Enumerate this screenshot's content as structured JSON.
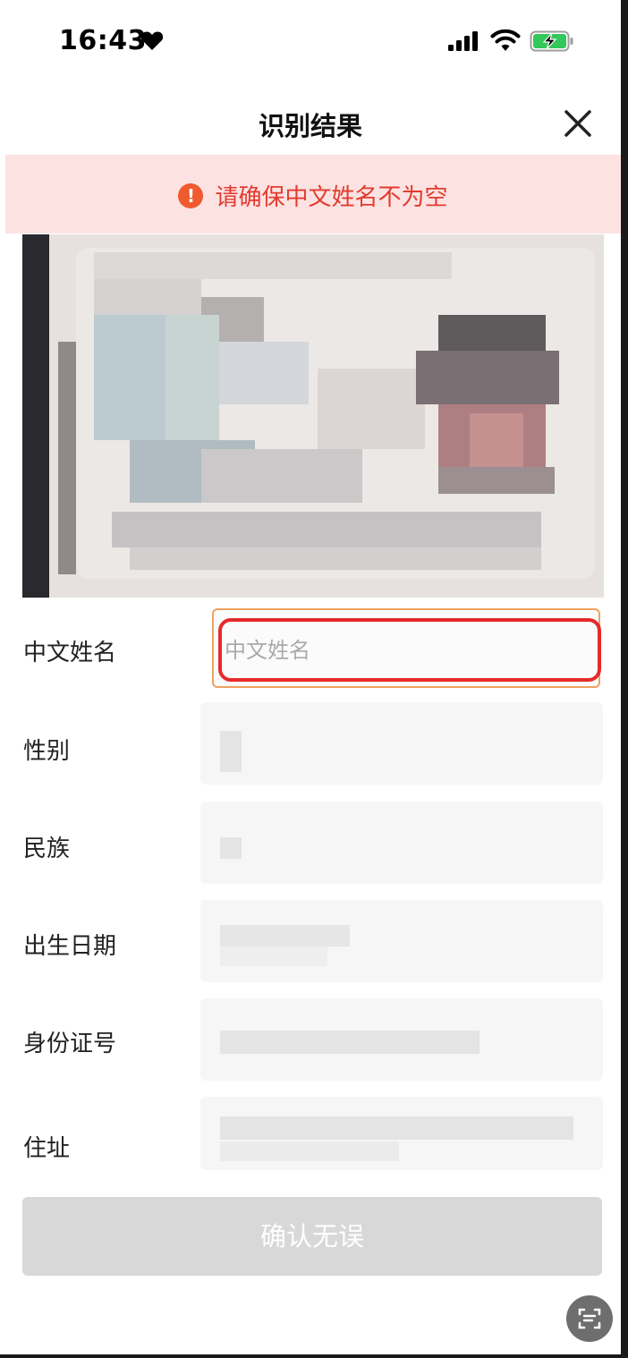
{
  "status_bar": {
    "time": "16:43"
  },
  "header": {
    "title": "识别结果"
  },
  "alert": {
    "icon": "!",
    "message": "请确保中文姓名不为空",
    "color": "#e23b2e",
    "background": "#fde2e2"
  },
  "form": {
    "fields": [
      {
        "label": "中文姓名",
        "value": "",
        "placeholder": "中文姓名"
      },
      {
        "label": "性别",
        "value": ""
      },
      {
        "label": "民族",
        "value": ""
      },
      {
        "label": "出生日期",
        "value": ""
      },
      {
        "label": "身份证号",
        "value": ""
      },
      {
        "label": "住址",
        "value": ""
      }
    ]
  },
  "confirm_button": {
    "label": "确认无误"
  },
  "colors": {
    "accent_border": "#f0a15f",
    "highlight_outline": "#e52a2a",
    "disabled_button": "#d8d8d8"
  }
}
